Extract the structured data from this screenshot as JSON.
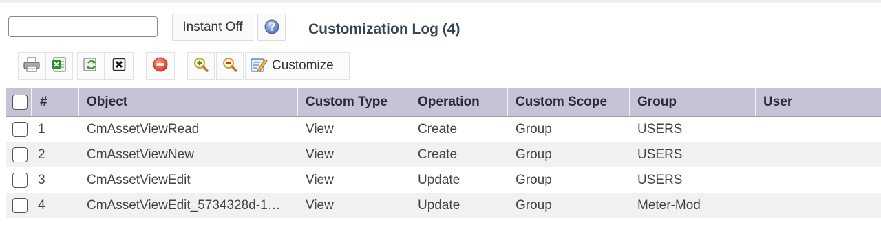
{
  "search": {
    "value": "",
    "placeholder": ""
  },
  "header": {
    "instant_label": "Instant Off",
    "title": "Customization Log (4)"
  },
  "toolbar": {
    "customize_label": "Customize",
    "icons": [
      "print-icon",
      "export-excel-icon",
      "refresh-icon",
      "delete-icon",
      "stop-icon",
      "zoom-in-icon",
      "zoom-out-icon",
      "customize-icon"
    ]
  },
  "grid": {
    "columns": [
      "#",
      "Object",
      "Custom Type",
      "Operation",
      "Custom Scope",
      "Group",
      "User"
    ],
    "rows": [
      {
        "num": "1",
        "object": "CmAssetViewRead",
        "custom_type": "View",
        "operation": "Create",
        "scope": "Group",
        "group": "USERS",
        "user": ""
      },
      {
        "num": "2",
        "object": "CmAssetViewNew",
        "custom_type": "View",
        "operation": "Create",
        "scope": "Group",
        "group": "USERS",
        "user": ""
      },
      {
        "num": "3",
        "object": "CmAssetViewEdit",
        "custom_type": "View",
        "operation": "Update",
        "scope": "Group",
        "group": "USERS",
        "user": ""
      },
      {
        "num": "4",
        "object": "CmAssetViewEdit_5734328d-1…",
        "custom_type": "View",
        "operation": "Update",
        "scope": "Group",
        "group": "Meter-Mod",
        "user": ""
      }
    ]
  },
  "colors": {
    "header_bg": "#c4c4d6",
    "alt_row": "#f1f1f4",
    "title": "#3a4552"
  }
}
